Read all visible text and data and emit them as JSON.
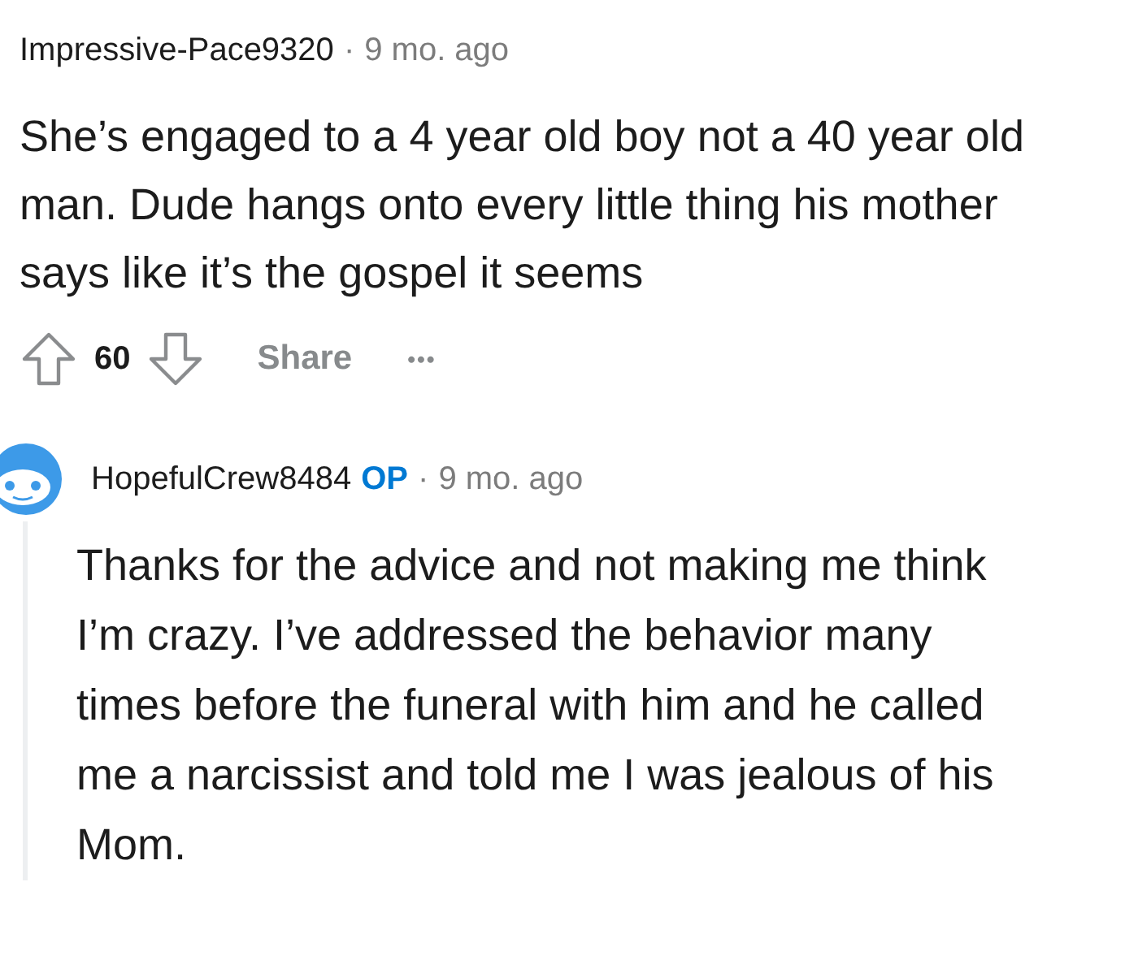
{
  "comments": [
    {
      "kind": "comment",
      "author": "Impressive-Pace9320",
      "separator": "·",
      "time": "9 mo. ago",
      "body": "She’s engaged to a 4 year old boy not a 40 year old man. Dude hangs onto every little thing his mother says like it’s the gospel it seems",
      "votes": "60",
      "share": "Share",
      "more": "•••"
    },
    {
      "kind": "reply",
      "author": "HopefulCrew8484",
      "op_badge": "OP",
      "separator": "·",
      "time": "9 mo. ago",
      "body": "Thanks for the advice and not making me think I’m crazy. I’ve addressed the behavior many times before the funeral with him and he called me a narcissist and told me I was jealous of his Mom."
    }
  ]
}
